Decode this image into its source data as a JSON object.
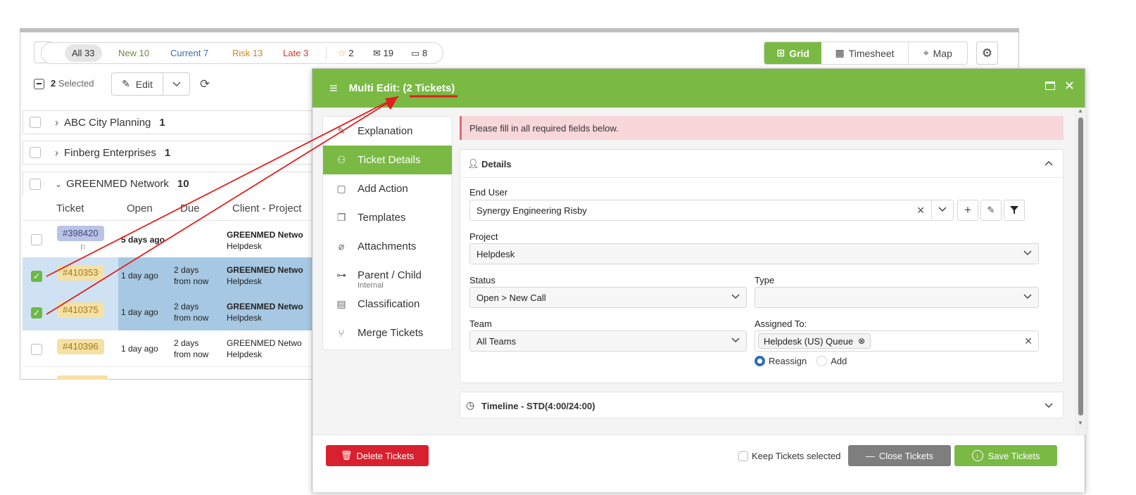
{
  "filters": {
    "all": {
      "label": "All",
      "count": "33"
    },
    "new": {
      "label": "New",
      "count": "10"
    },
    "current": {
      "label": "Current",
      "count": "7"
    },
    "risk": {
      "label": "Risk",
      "count": "13"
    },
    "late": {
      "label": "Late",
      "count": "3"
    },
    "starred": "2",
    "mail": "19",
    "chat": "8"
  },
  "view_switch": {
    "grid": "Grid",
    "timesheet": "Timesheet",
    "map": "Map"
  },
  "selection": {
    "count": "2",
    "label": "Selected",
    "edit_label": "Edit"
  },
  "groups": [
    {
      "name": "ABC City Planning",
      "count": "1"
    },
    {
      "name": "Finberg Enterprises",
      "count": "1"
    },
    {
      "name": "GREENMED Network",
      "count": "10"
    }
  ],
  "columns": {
    "ticket": "Ticket",
    "open": "Open",
    "due": "Due",
    "client": "Client - Project"
  },
  "rows": [
    {
      "ticket": "#398420",
      "open": "5 days ago",
      "due_1": "",
      "due_2": "",
      "client": "GREENMED Netwo",
      "project": "Helpdesk"
    },
    {
      "ticket": "#410353",
      "open": "1 day ago",
      "due_1": "2 days",
      "due_2": "from now",
      "client": "GREENMED Netwo",
      "project": "Helpdesk"
    },
    {
      "ticket": "#410375",
      "open": "1 day ago",
      "due_1": "2 days",
      "due_2": "from now",
      "client": "GREENMED Netwo",
      "project": "Helpdesk"
    },
    {
      "ticket": "#410396",
      "open": "1 day ago",
      "due_1": "2 days",
      "due_2": "from now",
      "client": "GREENMED Netwo",
      "project": "Helpdesk"
    }
  ],
  "modal": {
    "title_prefix": "Multi Edit:",
    "title_count": "(2 Tickets)",
    "nav": [
      "Explanation",
      "Ticket Details",
      "Add Action",
      "Templates",
      "Attachments",
      "Parent / Child",
      "Classification",
      "Merge Tickets"
    ],
    "nav_overlap_text": "Internal",
    "alert": "Please fill in all required fields below.",
    "details": {
      "title": "Details",
      "end_user_label": "End User",
      "end_user_value": "Synergy Engineering Risby",
      "project_label": "Project",
      "project_value": "Helpdesk",
      "status_label": "Status",
      "status_value": "Open > New Call",
      "type_label": "Type",
      "type_value": "",
      "team_label": "Team",
      "team_value": "All Teams",
      "assigned_label": "Assigned To:",
      "assigned_chip": "Helpdesk (US) Queue",
      "reassign_label": "Reassign",
      "add_label": "Add"
    },
    "timeline_title": "Timeline - STD(4:00/24:00)",
    "footer": {
      "delete": "Delete Tickets",
      "keep_selected": "Keep Tickets selected",
      "close": "Close Tickets",
      "save": "Save Tickets"
    }
  },
  "colors": {
    "brand_green": "#7aba44",
    "alert_bg": "#f8d7da",
    "delete_red": "#d9202e",
    "close_gray": "#7e7e7e",
    "annotation_red": "#e0201e"
  }
}
